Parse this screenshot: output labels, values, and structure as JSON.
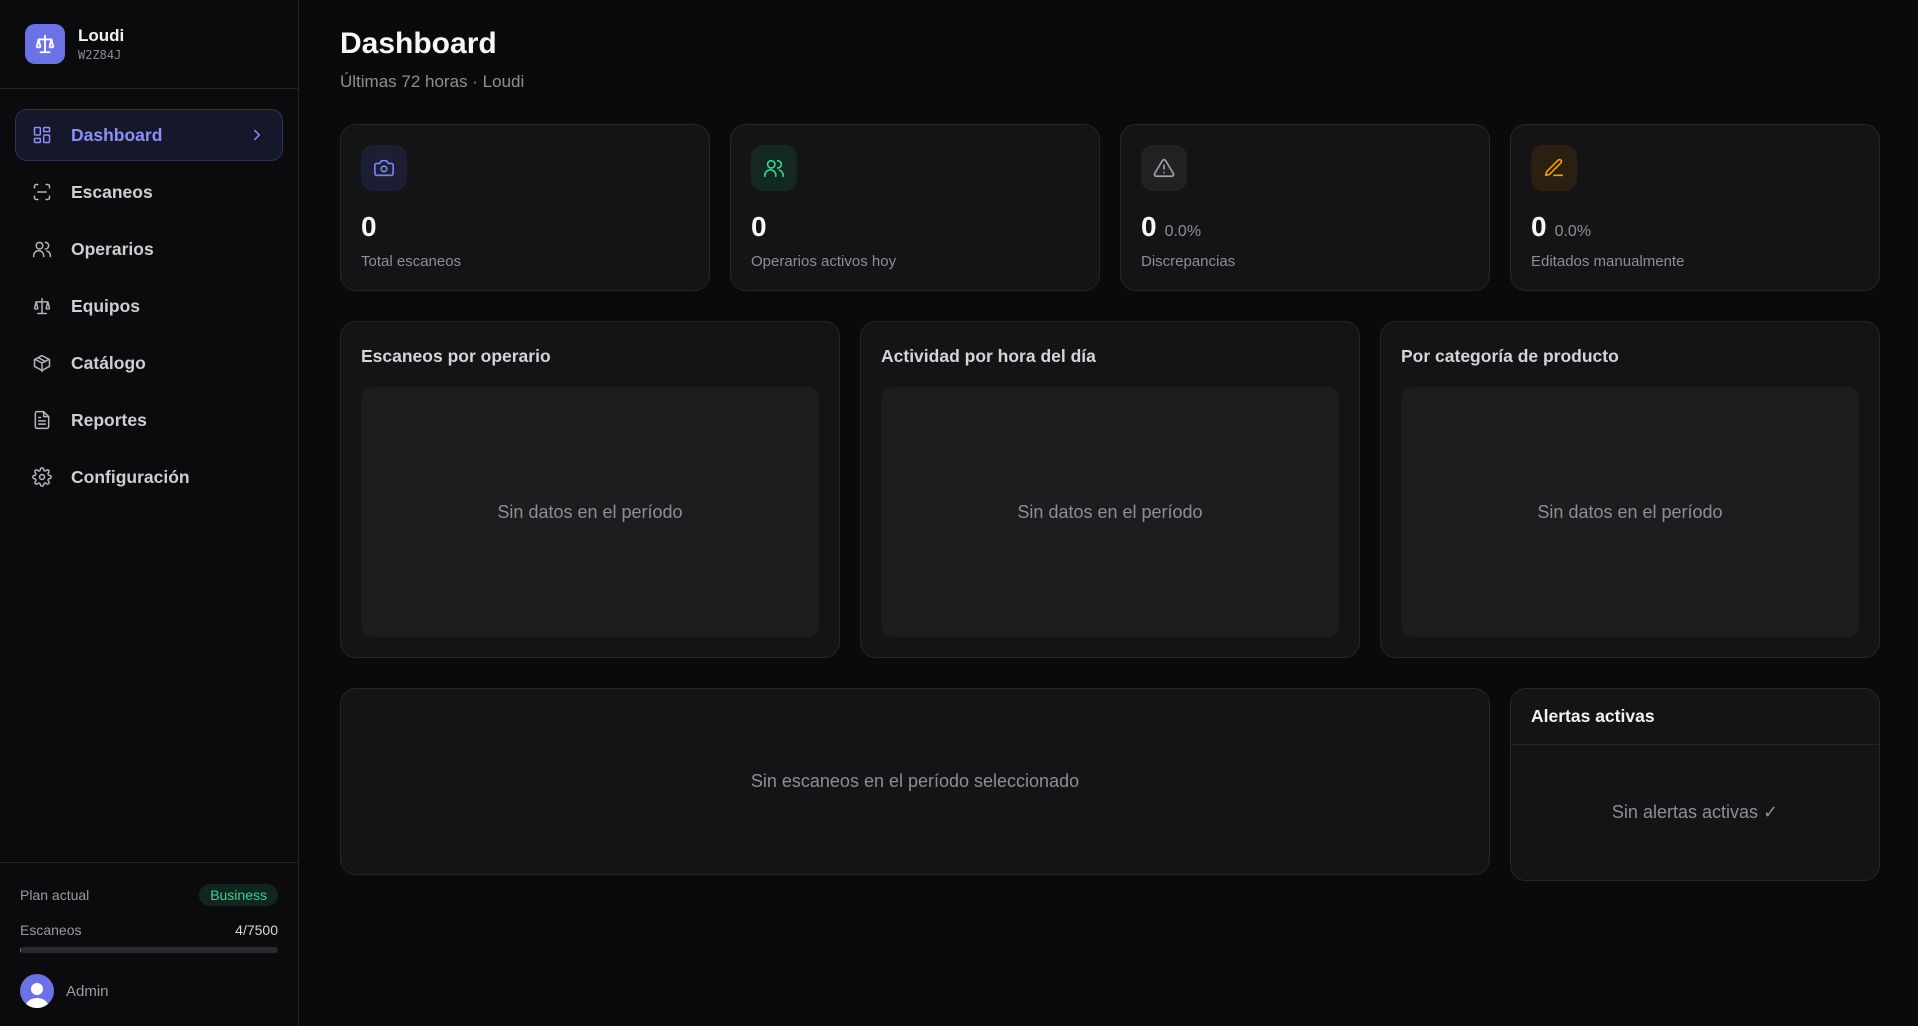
{
  "brand": {
    "name": "Loudi",
    "code": "W2Z84J"
  },
  "nav": {
    "items": [
      {
        "label": "Dashboard",
        "icon": "dashboard-icon",
        "active": true
      },
      {
        "label": "Escaneos",
        "icon": "scan-icon"
      },
      {
        "label": "Operarios",
        "icon": "users-icon"
      },
      {
        "label": "Equipos",
        "icon": "scale-icon"
      },
      {
        "label": "Catálogo",
        "icon": "box-icon"
      },
      {
        "label": "Reportes",
        "icon": "file-icon"
      },
      {
        "label": "Configuración",
        "icon": "gear-icon"
      }
    ]
  },
  "footer": {
    "plan_label": "Plan actual",
    "plan_badge": "Business",
    "usage_label": "Escaneos",
    "usage_value": "4/7500",
    "usage_fraction": 0.000533,
    "user_name": "Admin"
  },
  "header": {
    "title": "Dashboard",
    "subtitle": "Últimas 72 horas · Loudi"
  },
  "stats": [
    {
      "value": "0",
      "pct": "",
      "label": "Total escaneos",
      "icon": "camera-icon",
      "color": "#6b72e6"
    },
    {
      "value": "0",
      "pct": "",
      "label": "Operarios activos hoy",
      "icon": "users-icon",
      "color": "#34d399"
    },
    {
      "value": "0",
      "pct": "0.0%",
      "label": "Discrepancias",
      "icon": "warning-icon",
      "color": "#a1a1a6"
    },
    {
      "value": "0",
      "pct": "0.0%",
      "label": "Editados manualmente",
      "icon": "pencil-icon",
      "color": "#f59e0b"
    }
  ],
  "charts": [
    {
      "title": "Escaneos por operario",
      "empty": "Sin datos en el período"
    },
    {
      "title": "Actividad por hora del día",
      "empty": "Sin datos en el período"
    },
    {
      "title": "Por categoría de producto",
      "empty": "Sin datos en el período"
    }
  ],
  "scans_table": {
    "empty": "Sin escaneos en el período seleccionado"
  },
  "alerts": {
    "title": "Alertas activas",
    "empty": "Sin alertas activas ✓"
  }
}
